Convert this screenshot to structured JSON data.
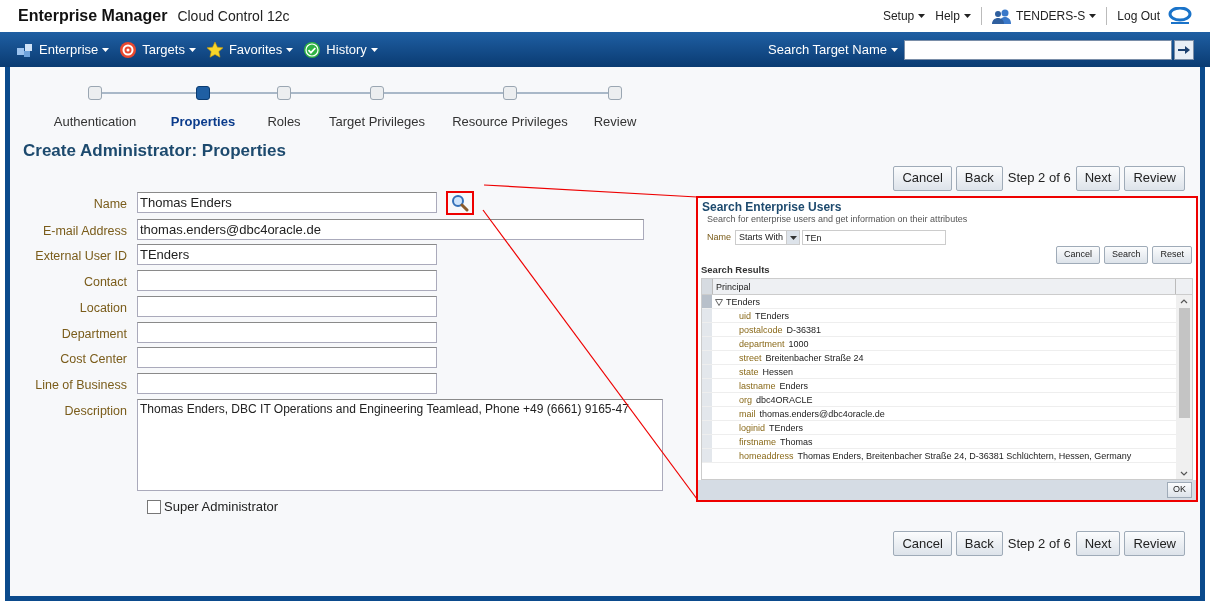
{
  "header": {
    "product": "Enterprise Manager",
    "subtitle": "Cloud Control 12c",
    "menus": [
      {
        "label": "Setup"
      },
      {
        "label": "Help"
      }
    ],
    "user": "TENDERS-S",
    "logout": "Log Out"
  },
  "nav": {
    "items": [
      {
        "label": "Enterprise"
      },
      {
        "label": "Targets"
      },
      {
        "label": "Favorites"
      },
      {
        "label": "History"
      }
    ],
    "search_label": "Search Target Name"
  },
  "train": [
    {
      "label": "Authentication",
      "selected": false
    },
    {
      "label": "Properties",
      "selected": true
    },
    {
      "label": "Roles",
      "selected": false
    },
    {
      "label": "Target Privileges",
      "selected": false
    },
    {
      "label": "Resource Privileges",
      "selected": false
    },
    {
      "label": "Review",
      "selected": false
    }
  ],
  "page_title": "Create Administrator: Properties",
  "top_actions": {
    "buttons": [
      "Cancel",
      "Back"
    ],
    "step": "Step 2 of 6",
    "after": [
      "Next",
      "Review"
    ]
  },
  "fields": [
    {
      "label": "Name",
      "value": "Thomas Enders",
      "kind": "lookup"
    },
    {
      "label": "E-mail Address",
      "value": "thomas.enders@dbc4oracle.de",
      "kind": "wide"
    },
    {
      "label": "External User ID",
      "value": "TEnders",
      "kind": "text"
    },
    {
      "label": "Contact",
      "kind": "text"
    },
    {
      "label": "Location",
      "kind": "text"
    },
    {
      "label": "Department",
      "kind": "text"
    },
    {
      "label": "Cost Center",
      "kind": "text"
    },
    {
      "label": "Line of Business",
      "kind": "text"
    },
    {
      "label": "Description",
      "value": "Thomas Enders, DBC IT Operations and Engineering Teamlead, Phone +49 (6661) 9165-47",
      "kind": "textarea"
    }
  ],
  "super_admin": {
    "label": "Super Administrator",
    "checked": false
  },
  "bottom_actions": {
    "buttons": [
      "Cancel",
      "Back"
    ],
    "step": "Step 2 of 6",
    "after": [
      "Next",
      "Review"
    ]
  },
  "popup": {
    "title": "Search Enterprise Users",
    "description": "Search for enterprise users and get information on their attributes",
    "filter": {
      "label": "Name",
      "operator": "Starts With",
      "value": "TEn"
    },
    "buttons": [
      "Cancel",
      "Search",
      "Reset"
    ],
    "results_title": "Search Results",
    "column": "Principal",
    "tree": {
      "label": "TEnders",
      "expanded": true,
      "children": [
        {
          "name": "uid",
          "value": "TEnders"
        },
        {
          "name": "postalcode",
          "value": "D-36381"
        },
        {
          "name": "department",
          "value": "1000"
        },
        {
          "name": "street",
          "value": "Breitenbacher Straße 24"
        },
        {
          "name": "state",
          "value": "Hessen"
        },
        {
          "name": "lastname",
          "value": "Enders"
        },
        {
          "name": "org",
          "value": "dbc4ORACLE"
        },
        {
          "name": "mail",
          "value": "thomas.enders@dbc4oracle.de"
        },
        {
          "name": "loginid",
          "value": "TEnders"
        },
        {
          "name": "firstname",
          "value": "Thomas"
        },
        {
          "name": "homeaddress",
          "value": "Thomas Enders, Breitenbacher Straße 24, D-36381 Schlüchtern, Hessen, Germany"
        }
      ]
    },
    "ok": "OK"
  }
}
